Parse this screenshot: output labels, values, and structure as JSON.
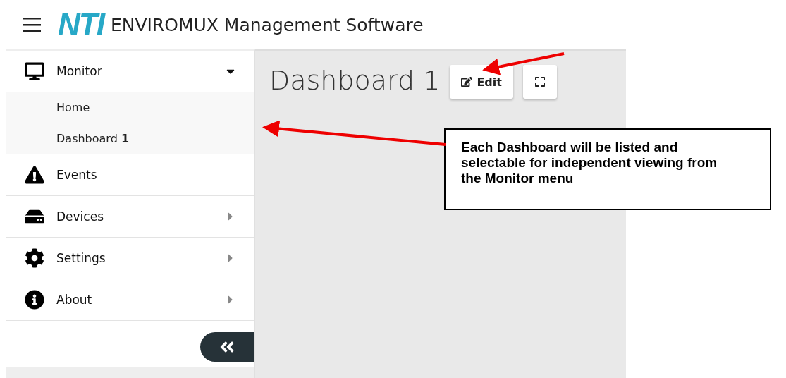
{
  "header": {
    "logo": "NTI",
    "title": "ENVIROMUX Management Software"
  },
  "sidebar": {
    "items": [
      {
        "label": "Monitor",
        "expanded": true,
        "children": [
          {
            "label": "Home"
          },
          {
            "label": "Dashboard **1**"
          }
        ]
      },
      {
        "label": "Events"
      },
      {
        "label": "Devices",
        "expanded": false
      },
      {
        "label": "Settings",
        "expanded": false
      },
      {
        "label": "About",
        "expanded": false
      }
    ]
  },
  "main": {
    "title": "Dashboard 1",
    "buttons": [
      {
        "label": "Edit"
      }
    ]
  },
  "callout": {
    "text": "Each Dashboard will be listed and selectable for independent viewing from the Monitor menu"
  }
}
